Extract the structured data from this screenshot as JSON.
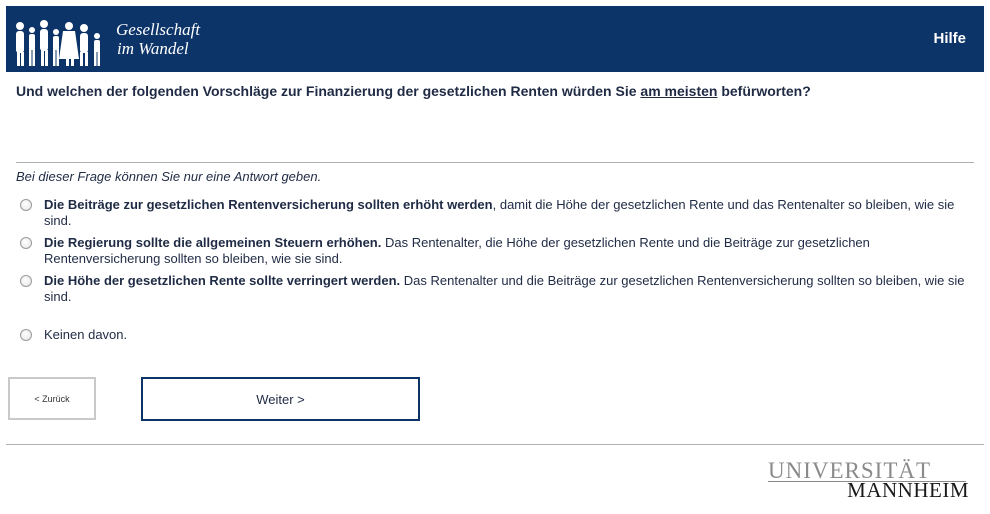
{
  "header": {
    "logo_line1": "Gesellschaft",
    "logo_line2": "im Wandel",
    "help_label": "Hilfe"
  },
  "question": {
    "text_before": "Und welchen der folgenden Vorschläge zur Finanzierung der gesetzlichen Renten würden Sie ",
    "emphasis": "am meisten",
    "text_after": " befürworten?"
  },
  "instruction": "Bei dieser Frage können Sie nur eine Antwort geben.",
  "options": [
    {
      "bold": "Die Beiträge zur gesetzlichen Rentenversicherung sollten erhöht werden",
      "rest": ", damit die Höhe der gesetzlichen Rente und das Rentenalter so bleiben, wie sie sind."
    },
    {
      "bold": "Die Regierung sollte die allgemeinen Steuern erhöhen.",
      "rest": " Das Rentenalter, die Höhe der gesetzlichen Rente und die Beiträge zur gesetzlichen Rentenversicherung sollten so bleiben, wie sie sind."
    },
    {
      "bold": "Die Höhe der gesetzlichen Rente sollte verringert werden.",
      "rest": " Das Rentenalter und die Beiträge zur gesetzlichen Rentenversicherung sollten so bleiben, wie sie sind."
    },
    {
      "bold": "",
      "rest": "Keinen davon."
    }
  ],
  "buttons": {
    "back_label": "< Zurück",
    "next_label": "Weiter >"
  },
  "footer": {
    "university_line1": "UNIVERSITÄT",
    "university_line2": "MANNHEIM"
  },
  "colors": {
    "header_bg": "#0d3469",
    "text": "#1f2a44"
  }
}
